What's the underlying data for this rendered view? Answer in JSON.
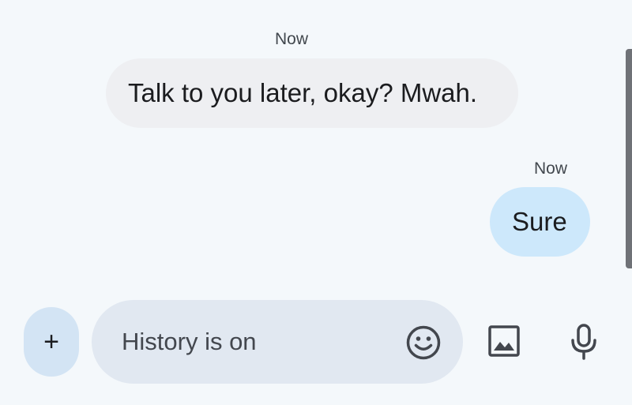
{
  "conversation": {
    "messages": [
      {
        "direction": "incoming",
        "timestamp": "Now",
        "text": "Talk to you later, okay? Mwah."
      },
      {
        "direction": "outgoing",
        "timestamp": "Now",
        "text": "Sure"
      }
    ]
  },
  "composer": {
    "add_button_label": "+",
    "placeholder": "History is on",
    "icons": {
      "add": "plus-icon",
      "emoji": "emoji-icon",
      "gallery": "image-icon",
      "voice": "microphone-icon"
    }
  },
  "colors": {
    "background": "#f4f8fb",
    "incoming_bubble": "#eeeff2",
    "outgoing_bubble": "#cde8fb",
    "compose_field": "#e1e8f1",
    "add_button": "#d3e4f4"
  }
}
